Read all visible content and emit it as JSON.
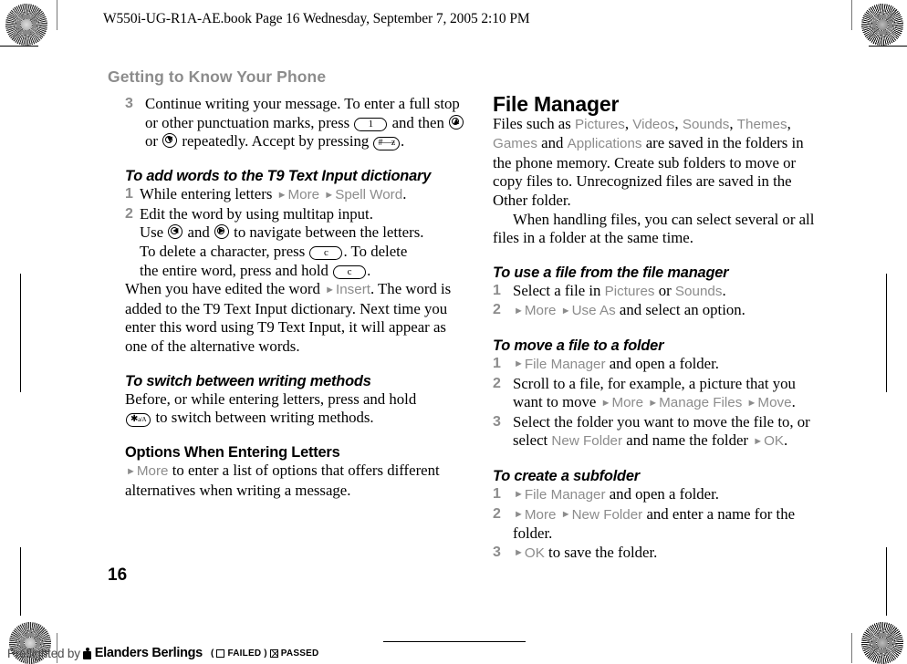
{
  "header": {
    "book_line": "W550i-UG-R1A-AE.book  Page 16  Wednesday, September 7, 2005  2:10 PM"
  },
  "chapter": {
    "title": "Getting to Know Your Phone"
  },
  "page_number": "16",
  "left_column": {
    "step3": {
      "num": "3",
      "t1": "Continue writing your message. To enter a full stop or other punctuation marks, press",
      "key1": "1",
      "t2": "and then",
      "t3": "or",
      "t4": "repeatedly. Accept by pressing",
      "key_hash": "#",
      "t5": "."
    },
    "section_t9": {
      "heading": "To add words to the T9 Text Input dictionary",
      "steps": [
        {
          "num": "1",
          "pre": "While entering letters",
          "ui1": "More",
          "ui2": "Spell Word",
          "post": "."
        },
        {
          "num": "2",
          "l1": "Edit the word by using multitap input.",
          "l2a": "Use",
          "l2b": "and",
          "l2c": "to navigate between the letters.",
          "l3a": "To delete a character, press",
          "key_c": "c",
          "l3b": ". To delete",
          "l4a": "the entire word, press and hold",
          "l4b": "."
        }
      ],
      "after_a": "When you have edited the word",
      "after_ui": "Insert",
      "after_b": ". The word is added to the T9 Text Input dictionary. Next time you enter this word using T9 Text Input, it will appear as one of the alternative words."
    },
    "section_switch": {
      "heading": "To switch between writing methods",
      "t1": "Before, or while entering letters, press and hold",
      "key_star": "a/A",
      "t2": "to switch between writing methods."
    },
    "section_options": {
      "heading": "Options When Entering Letters",
      "ui1": "More",
      "t1": "to enter a list of options that offers different alternatives when writing a message."
    }
  },
  "right_column": {
    "title": "File Manager",
    "intro": {
      "a": "Files such as",
      "ui": [
        "Pictures",
        "Videos",
        "Sounds",
        "Themes",
        "Games",
        "Applications"
      ],
      "b": "and",
      "c": "are saved in the folders in the phone memory. Create sub folders to move or copy files to. Unrecognized files are saved in the Other folder.",
      "d": "When handling files, you can select several or all files in a folder at the same time."
    },
    "section_use": {
      "heading": "To use a file from the file manager",
      "steps": [
        {
          "num": "1",
          "pre": "Select a file in",
          "ui1": "Pictures",
          "mid": "or",
          "ui2": "Sounds",
          "post": "."
        },
        {
          "num": "2",
          "ui1": "More",
          "ui2": "Use As",
          "post": "and select an option."
        }
      ]
    },
    "section_move": {
      "heading": "To move a file to a folder",
      "steps": [
        {
          "num": "1",
          "ui1": "File Manager",
          "post": "and open a folder."
        },
        {
          "num": "2",
          "pre": "Scroll to a file, for example, a picture that you want to move",
          "ui1": "More",
          "ui2": "Manage Files",
          "ui3": "Move",
          "post": "."
        },
        {
          "num": "3",
          "pre": "Select the folder you want to move the file to, or select",
          "ui1": "New Folder",
          "mid": "and name the folder",
          "ui2": "OK",
          "post": "."
        }
      ]
    },
    "section_create": {
      "heading": "To create a subfolder",
      "steps": [
        {
          "num": "1",
          "ui1": "File Manager",
          "post": "and open a folder."
        },
        {
          "num": "2",
          "ui1": "More",
          "ui2": "New Folder",
          "post": "and enter a name for the folder."
        },
        {
          "num": "3",
          "ui1": "OK",
          "post": "to save the folder."
        }
      ]
    }
  },
  "preflight": {
    "by_text": "Preflighted by",
    "brand": "Elanders Berlings",
    "open_paren": "(",
    "failed_label": "FAILED",
    "close_paren": ")",
    "passed_label": "PASSED"
  },
  "colors": {
    "ui_gray": "#8c8c8c",
    "chapter_gray": "#8c8c8c",
    "text_black": "#000000"
  }
}
